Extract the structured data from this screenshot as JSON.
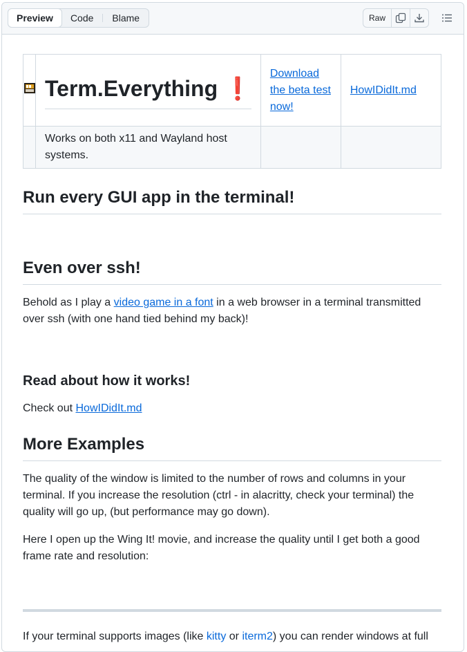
{
  "toolbar": {
    "tabs": [
      "Preview",
      "Code",
      "Blame"
    ],
    "raw_label": "Raw"
  },
  "hero_table": {
    "title": "Term.Everything",
    "title_emoji": "❗",
    "download_link": "Download the beta test now!",
    "howto_link": "HowIDidIt.md",
    "subtitle": "Works on both x11 and Wayland host systems."
  },
  "sections": {
    "h_run": "Run every GUI app in the terminal!",
    "h_ssh": "Even over ssh!",
    "p_behold_1": "Behold as I play a ",
    "p_behold_link": "video game in a font",
    "p_behold_2": " in a web browser in a terminal transmitted over ssh (with one hand tied behind my back)!",
    "h_read": "Read about how it works!",
    "p_check": "Check out ",
    "p_check_link": "HowIDidIt.md",
    "h_more": "More Examples",
    "p_quality": "The quality of the window is limited to the number of rows and columns in your terminal. If you increase the resolution (ctrl - in alacritty, check your terminal) the quality will go up, (but performance may go down).",
    "p_wing": "Here I open up the Wing It! movie, and increase the quality until I get both a good frame rate and resolution:",
    "p_images_1": "If your terminal supports images (like ",
    "p_images_kitty": "kitty",
    "p_images_2": " or ",
    "p_images_iterm": "iterm2",
    "p_images_3": ") you can render windows at full"
  },
  "colors": {
    "link": "#0969da",
    "border": "#d1d9e0",
    "text": "#1f2328",
    "accent_red": "#d1242f"
  }
}
